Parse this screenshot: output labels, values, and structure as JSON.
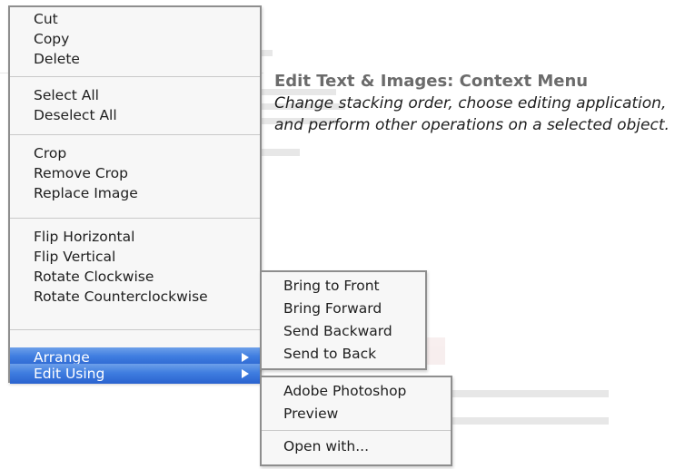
{
  "caption": {
    "title": "Edit Text & Images: Context Menu",
    "description": "Change stacking order, choose editing application, and perform other operations on a selected object."
  },
  "context_menu": {
    "groups": [
      [
        "Cut",
        "Copy",
        "Delete"
      ],
      [
        "Select All",
        "Deselect All"
      ],
      [
        "Crop",
        "Remove Crop",
        "Replace Image"
      ],
      [
        "Flip Horizontal",
        "Flip Vertical",
        "Rotate Clockwise",
        "Rotate Counterclockwise"
      ]
    ],
    "arrange_label": "Arrange",
    "edit_using_label": "Edit Using",
    "submenu_icon": "chevron-right-icon"
  },
  "arrange_submenu": {
    "items": [
      "Bring to Front",
      "Bring Forward",
      "Send Backward",
      "Send to Back"
    ]
  },
  "edit_using_submenu": {
    "items": [
      "Adobe Photoshop",
      "Preview"
    ],
    "open_with": "Open with..."
  },
  "colors": {
    "highlight": "#3f7de0",
    "menu_background": "#f7f7f7",
    "caption_title": "#6b6b6b"
  }
}
